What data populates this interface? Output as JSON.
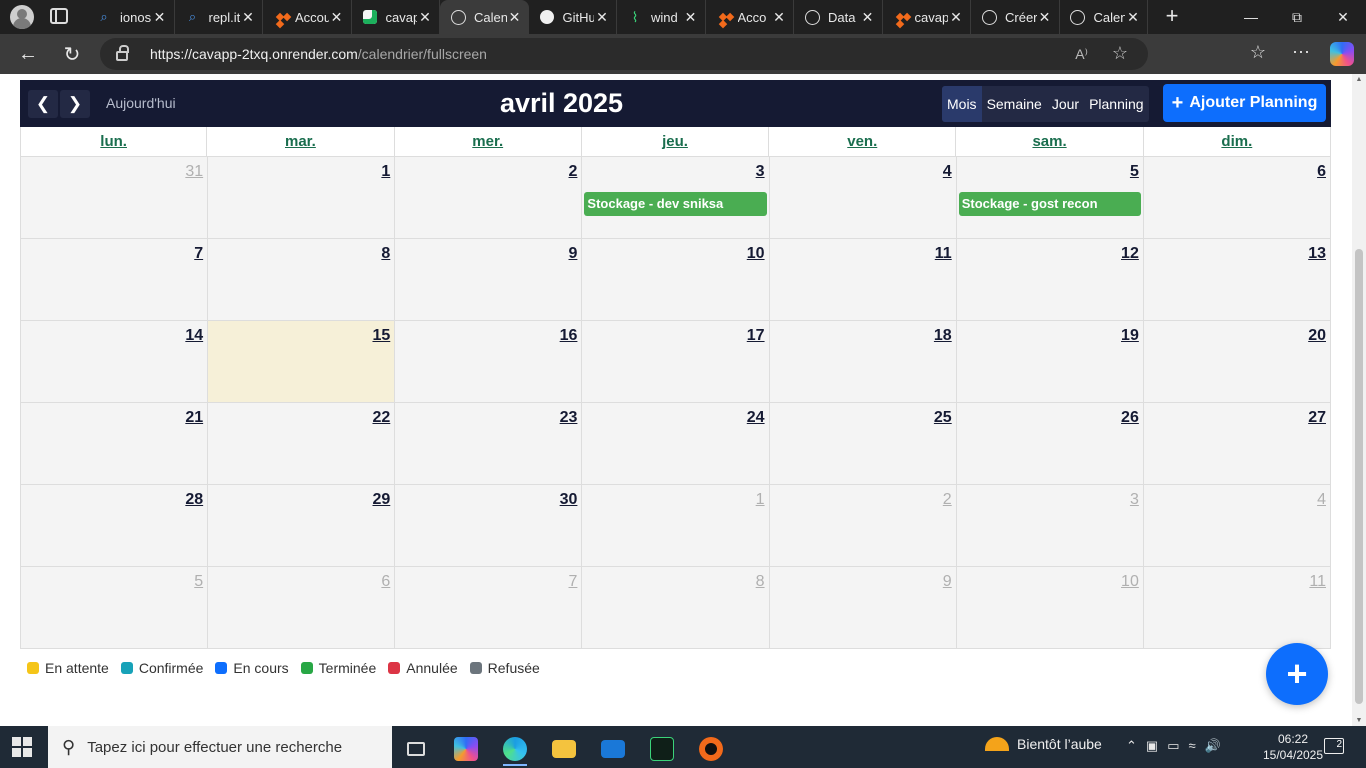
{
  "browser": {
    "tabs": [
      {
        "title": "ionos",
        "icon": "search-icon"
      },
      {
        "title": "repl.it",
        "icon": "search-icon"
      },
      {
        "title": "Accou",
        "icon": "orange-diamond-icon"
      },
      {
        "title": "cavap",
        "icon": "cavapp-icon"
      },
      {
        "title": "Calen",
        "icon": "globe-icon",
        "active": true
      },
      {
        "title": "GitHu",
        "icon": "github-icon"
      },
      {
        "title": "wind",
        "icon": "windsurf-icon"
      },
      {
        "title": "Acco",
        "icon": "orange-diamond-icon"
      },
      {
        "title": "Data",
        "icon": "globe-icon"
      },
      {
        "title": "cavap",
        "icon": "orange-diamond-icon"
      },
      {
        "title": "Créer",
        "icon": "globe-icon"
      },
      {
        "title": "Calen",
        "icon": "globe-icon"
      }
    ],
    "url_host": "https://cavapp-2txq.onrender.com",
    "url_path": "/calendrier/fullscreen"
  },
  "calendar": {
    "title": "avril 2025",
    "today_label": "Aujourd'hui",
    "views": [
      "Mois",
      "Semaine",
      "Jour",
      "Planning"
    ],
    "active_view": "Mois",
    "add_label": "Ajouter Planning",
    "weekdays": [
      "lun.",
      "mar.",
      "mer.",
      "jeu.",
      "ven.",
      "sam.",
      "dim."
    ],
    "days": [
      {
        "n": "31",
        "other": true
      },
      {
        "n": "1"
      },
      {
        "n": "2"
      },
      {
        "n": "3",
        "event": "Stockage - dev sniksa"
      },
      {
        "n": "4"
      },
      {
        "n": "5",
        "event": "Stockage - gost recon"
      },
      {
        "n": "6"
      },
      {
        "n": "7"
      },
      {
        "n": "8"
      },
      {
        "n": "9"
      },
      {
        "n": "10"
      },
      {
        "n": "11"
      },
      {
        "n": "12"
      },
      {
        "n": "13"
      },
      {
        "n": "14"
      },
      {
        "n": "15",
        "today": true
      },
      {
        "n": "16"
      },
      {
        "n": "17"
      },
      {
        "n": "18"
      },
      {
        "n": "19"
      },
      {
        "n": "20"
      },
      {
        "n": "21"
      },
      {
        "n": "22"
      },
      {
        "n": "23"
      },
      {
        "n": "24"
      },
      {
        "n": "25"
      },
      {
        "n": "26"
      },
      {
        "n": "27"
      },
      {
        "n": "28"
      },
      {
        "n": "29"
      },
      {
        "n": "30"
      },
      {
        "n": "1",
        "other": true
      },
      {
        "n": "2",
        "other": true
      },
      {
        "n": "3",
        "other": true
      },
      {
        "n": "4",
        "other": true
      },
      {
        "n": "5",
        "other": true
      },
      {
        "n": "6",
        "other": true
      },
      {
        "n": "7",
        "other": true
      },
      {
        "n": "8",
        "other": true
      },
      {
        "n": "9",
        "other": true
      },
      {
        "n": "10",
        "other": true
      },
      {
        "n": "11",
        "other": true
      }
    ],
    "event_color": "#4aad52",
    "today_color": "#f6f0d8"
  },
  "legend": [
    {
      "label": "En attente",
      "color": "#f5c518"
    },
    {
      "label": "Confirmée",
      "color": "#17a2b8"
    },
    {
      "label": "En cours",
      "color": "#0d6efd"
    },
    {
      "label": "Terminée",
      "color": "#28a745"
    },
    {
      "label": "Annulée",
      "color": "#dc3545"
    },
    {
      "label": "Refusée",
      "color": "#6c757d"
    }
  ],
  "taskbar": {
    "search_placeholder": "Tapez ici pour effectuer une recherche",
    "weather": "Bientôt l’aube",
    "time": "06:22",
    "date": "15/04/2025",
    "notifications": "2"
  }
}
